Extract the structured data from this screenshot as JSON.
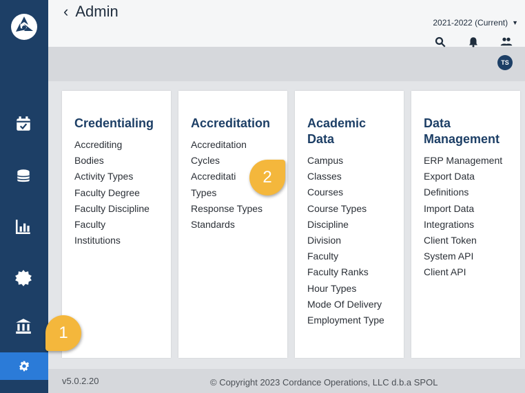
{
  "header": {
    "back_label": "Admin",
    "year_selector": "2021-2022 (Current)",
    "avatar_initials": "TS"
  },
  "sidebar": {
    "items": [
      {
        "name": "calendar-icon"
      },
      {
        "name": "database-icon"
      },
      {
        "name": "bar-chart-icon"
      },
      {
        "name": "badge-icon"
      },
      {
        "name": "institution-icon"
      },
      {
        "name": "gear-icon",
        "active": true
      }
    ]
  },
  "cards": [
    {
      "title": "Credentialing",
      "items": [
        "Accrediting",
        "Bodies",
        "Activity Types",
        "Faculty Degree",
        "Faculty Discipline",
        "Faculty",
        "Institutions"
      ]
    },
    {
      "title": "Accreditation",
      "items": [
        "Accreditation",
        "Cycles",
        "Accreditati",
        "Types",
        "Response Types",
        "Standards"
      ]
    },
    {
      "title_line1": "Academic",
      "title_line2": "Data",
      "items": [
        "Campus",
        "Classes",
        "Courses",
        "Course Types",
        "Discipline",
        "Division",
        "Faculty",
        "Faculty Ranks",
        "Hour Types",
        "Mode Of Delivery",
        "Employment Type"
      ]
    },
    {
      "title_line1": "Data",
      "title_line2": "Management",
      "items": [
        "ERP Management",
        "Export Data",
        "Definitions",
        "Import Data",
        "Integrations",
        "Client Token",
        "System API",
        "Client API"
      ]
    }
  ],
  "footer": {
    "version": "v5.0.2.20",
    "copyright": "© Copyright 2023 Cordance Operations, LLC d.b.a SPOL"
  },
  "callouts": {
    "one": "1",
    "two": "2"
  },
  "colors": {
    "sidebar": "#1d3f66",
    "active": "#2b7bd8",
    "heading": "#1d3f66",
    "callout": "#f4b73c"
  }
}
